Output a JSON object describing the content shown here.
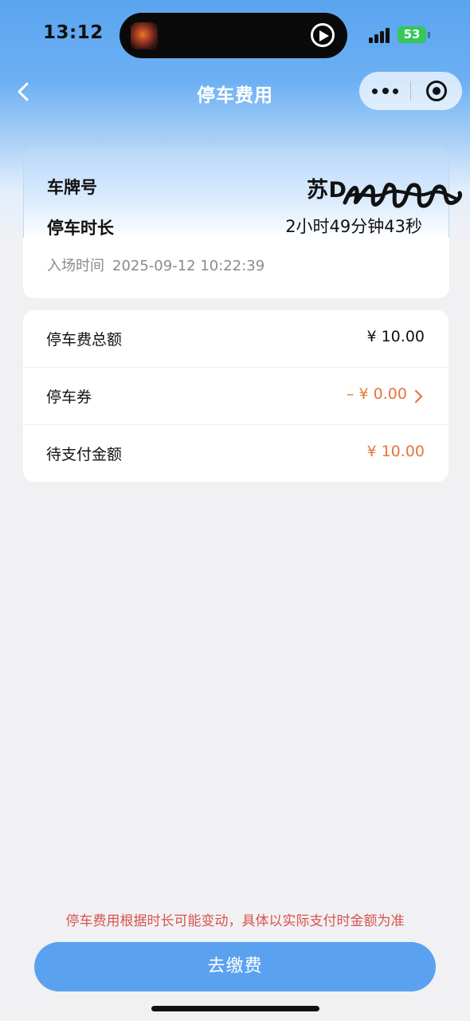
{
  "status_bar": {
    "time": "13:12",
    "battery": "53"
  },
  "navbar": {
    "title": "停车费用"
  },
  "vehicle": {
    "plate_label": "车牌号",
    "plate_value": "苏D",
    "duration_label": "停车时长",
    "duration_value": "2小时49分钟43秒",
    "entry_label": "入场时间",
    "entry_time": "2025-09-12 10:22:39"
  },
  "fees": {
    "total_label": "停车费总额",
    "total_value": "¥ 10.00",
    "coupon_label": "停车券",
    "coupon_value": "– ¥ 0.00",
    "due_label": "待支付金额",
    "due_value": "¥ 10.00"
  },
  "footer": {
    "notice": "停车费用根据时长可能变动，具体以实际支付时金额为准",
    "pay_button": "去缴费"
  },
  "colors": {
    "accent_blue": "#5aa2ef",
    "amount_orange": "#e4763b",
    "notice_red": "#d9534f",
    "battery_green": "#34c759"
  }
}
